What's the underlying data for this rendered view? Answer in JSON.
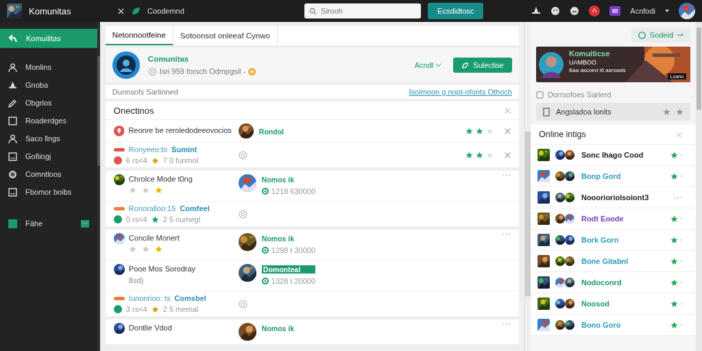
{
  "topbar": {
    "app_title": "Komunitas",
    "tab_label": "Coodemnd",
    "search": {
      "placeholder": "Sirooh"
    },
    "action_button": "Ecsdidtosc",
    "user_name": "Acnfodi"
  },
  "sidebar": {
    "items": [
      {
        "label": "Komuilitas",
        "selected": true
      },
      {
        "label": "Monlins",
        "selected": false
      },
      {
        "label": "Gnoba",
        "selected": false
      },
      {
        "label": "Obgrlos",
        "selected": false
      },
      {
        "label": "Roaderdges",
        "selected": false
      },
      {
        "label": "Saco llngs",
        "selected": false
      },
      {
        "label": "Gofiiogj",
        "selected": false
      },
      {
        "label": "Comntloos",
        "selected": false
      },
      {
        "label": "Fbomor boibs",
        "selected": false
      },
      {
        "label": "Fähe",
        "selected": false,
        "badge": true
      }
    ]
  },
  "tabs": [
    {
      "label": "Netonnootfeine",
      "selected": true
    },
    {
      "label": "Sotoonsot onleeaf Cynwo",
      "selected": false
    }
  ],
  "community": {
    "name": "Comunitas",
    "info": "Isri 959 forsch Odmpgsil -",
    "sort": "Acndl",
    "join_button": "Sulectise"
  },
  "info_bar": {
    "label": "Dunnsofs Sarlinned",
    "link": "Isolmoon g nopt-ofonts Othoch"
  },
  "section": {
    "title": "Onectinos",
    "groups": [
      [
        {
          "kind": "featured",
          "title": "Reonre be reroledodeeovocios",
          "user": {
            "name": "Rondol",
            "highlighted": false
          },
          "stars": 2
        },
        {
          "kind": "meta",
          "color": "#e05252",
          "label": "Ronyeeo:to",
          "tag": "Sumint",
          "stats": "6 rs<4",
          "count": "7 0 funmol",
          "stars": 2
        }
      ],
      [
        {
          "kind": "post",
          "title": "Chrolce Mode t0ng",
          "stars": 1,
          "menu": true,
          "user": {
            "name": "Nomos ik",
            "highlighted": false,
            "meta": "1218 630000"
          }
        },
        {
          "kind": "meta",
          "color": "#f07b3a",
          "label": "Ronoralloo:15",
          "tag": "Comfeel",
          "stats": "0 rs<4",
          "count": "2 5 numegl"
        }
      ],
      [
        {
          "kind": "post",
          "title": "Concile Monert",
          "stars": 1,
          "menu": true,
          "user": {
            "name": "Nomos ik",
            "highlighted": false,
            "meta": "1298 t 30000"
          }
        },
        {
          "kind": "post",
          "title": "Pooe Mos Sorodray",
          "subtitle": "8sd)",
          "menu": false,
          "user": {
            "name": "Domonteal",
            "highlighted": true,
            "meta": "1328 t 20000"
          }
        },
        {
          "kind": "meta",
          "color": "#f07b3a",
          "label": "Iunonrioo: ts",
          "tag": "Comsbel",
          "stats": "3 rs<4",
          "count": "2 5 memal"
        }
      ],
      [
        {
          "kind": "post",
          "title": "Dontlie Vdod",
          "menu": true,
          "user": {
            "name": "Nomos ik",
            "highlighted": false
          }
        }
      ]
    ]
  },
  "right": {
    "sort_button": "Sodeid",
    "banner": {
      "title": "Komuiticse",
      "subtitle": "UAMBOO",
      "caption": "Baa ascoed I6 asrsasis",
      "badge": "Loano"
    },
    "saved_label": "Dorrsofoes Sarierd",
    "saved_item": "Angsladoa lonits",
    "online": {
      "title": "Online intigs",
      "items": [
        {
          "name": "Sonc Ihago Cood",
          "color": "#222222",
          "kind": "starred"
        },
        {
          "name": "Bonp Gord",
          "color": "#2a9fb8",
          "kind": "starred"
        },
        {
          "name": "Nooorioriolsoiont3",
          "color": "#222222",
          "kind": "more"
        },
        {
          "name": "Rodt Eoode",
          "color": "#7a3fb0",
          "kind": "starred"
        },
        {
          "name": "Bork Gorn",
          "color": "#2a9fb8",
          "kind": "starred"
        },
        {
          "name": "Bone Gitabnl",
          "color": "#2a9fb8",
          "kind": "starred"
        },
        {
          "name": "Nodoconrd",
          "color": "#1a9b6c",
          "kind": "starred"
        },
        {
          "name": "Noosod",
          "color": "#1a9b6c",
          "kind": "starred"
        },
        {
          "name": "Bono Goro",
          "color": "#2a9fb8",
          "kind": "starred"
        }
      ]
    }
  }
}
